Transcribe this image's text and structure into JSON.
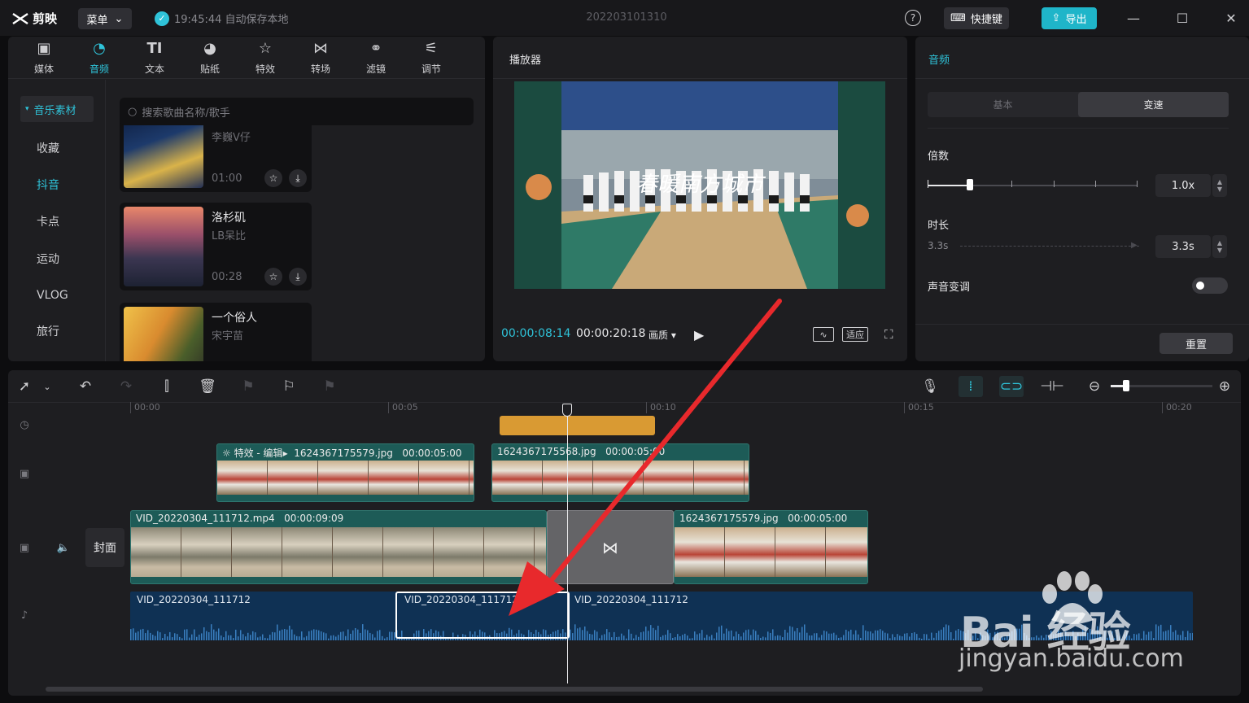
{
  "app": {
    "name": "剪映",
    "menu_label": "菜单",
    "autosave_text": "19:45:44 自动保存本地",
    "project_title": "202203101310",
    "shortcut_label": "快捷键",
    "export_label": "导出",
    "accent": "#2fc3d9"
  },
  "tabs": [
    {
      "label": "媒体",
      "icon": "media-icon"
    },
    {
      "label": "音频",
      "icon": "audio-icon",
      "active": true
    },
    {
      "label": "文本",
      "icon": "text-icon"
    },
    {
      "label": "贴纸",
      "icon": "sticker-icon"
    },
    {
      "label": "特效",
      "icon": "effects-icon"
    },
    {
      "label": "转场",
      "icon": "transition-icon"
    },
    {
      "label": "滤镜",
      "icon": "filter-icon"
    },
    {
      "label": "调节",
      "icon": "adjust-icon"
    }
  ],
  "sidebar": {
    "header": "音乐素材",
    "items": [
      "收藏",
      "抖音",
      "卡点",
      "运动",
      "VLOG",
      "旅行"
    ],
    "active_item": "抖音"
  },
  "search": {
    "placeholder": "搜索歌曲名称/歌手"
  },
  "music_list": [
    {
      "title": "",
      "artist": "李巍V仔",
      "duration": "01:00"
    },
    {
      "title": "洛杉矶",
      "artist": "LB呆比",
      "duration": "00:28"
    },
    {
      "title": "一个俗人",
      "artist": "宋宇苗",
      "duration": ""
    }
  ],
  "player": {
    "title": "播放器",
    "current_time": "00:00:08:14",
    "total_time": "00:00:20:18",
    "quality_label": "画质",
    "fit_label": "适应"
  },
  "audio_panel": {
    "title": "音频",
    "tabs": [
      "基本",
      "变速"
    ],
    "active_tab": "变速",
    "speed_label": "倍数",
    "speed_value": "1.0x",
    "speed_level": 0.2,
    "duration_label": "时长",
    "duration_orig": "3.3s",
    "duration_value": "3.3s",
    "pitch_label": "声音变调",
    "pitch_on": false,
    "reset_label": "重置"
  },
  "timeline": {
    "ruler_labels": [
      "00:00",
      "00:05",
      "00:10",
      "00:15",
      "00:20"
    ],
    "cover_label": "封面",
    "effect_clip_label": "特效 - 编辑",
    "overlay_clips": [
      {
        "name": "1624367175579.jpg",
        "duration": "00:00:05:00"
      },
      {
        "name": "1624367175568.jpg",
        "duration": "00:00:05:00"
      }
    ],
    "main_clips": [
      {
        "name": "VID_20220304_111712.mp4",
        "duration": "00:00:09:09"
      },
      {
        "name": "1624367175579.jpg",
        "duration": "00:00:05:00"
      }
    ],
    "audio_clips": [
      "VID_20220304_111712",
      "VID_20220304_111712",
      "VID_20220304_111712"
    ]
  },
  "watermark": {
    "brand": "Bai 经验",
    "url": "jingyan.baidu.com"
  }
}
